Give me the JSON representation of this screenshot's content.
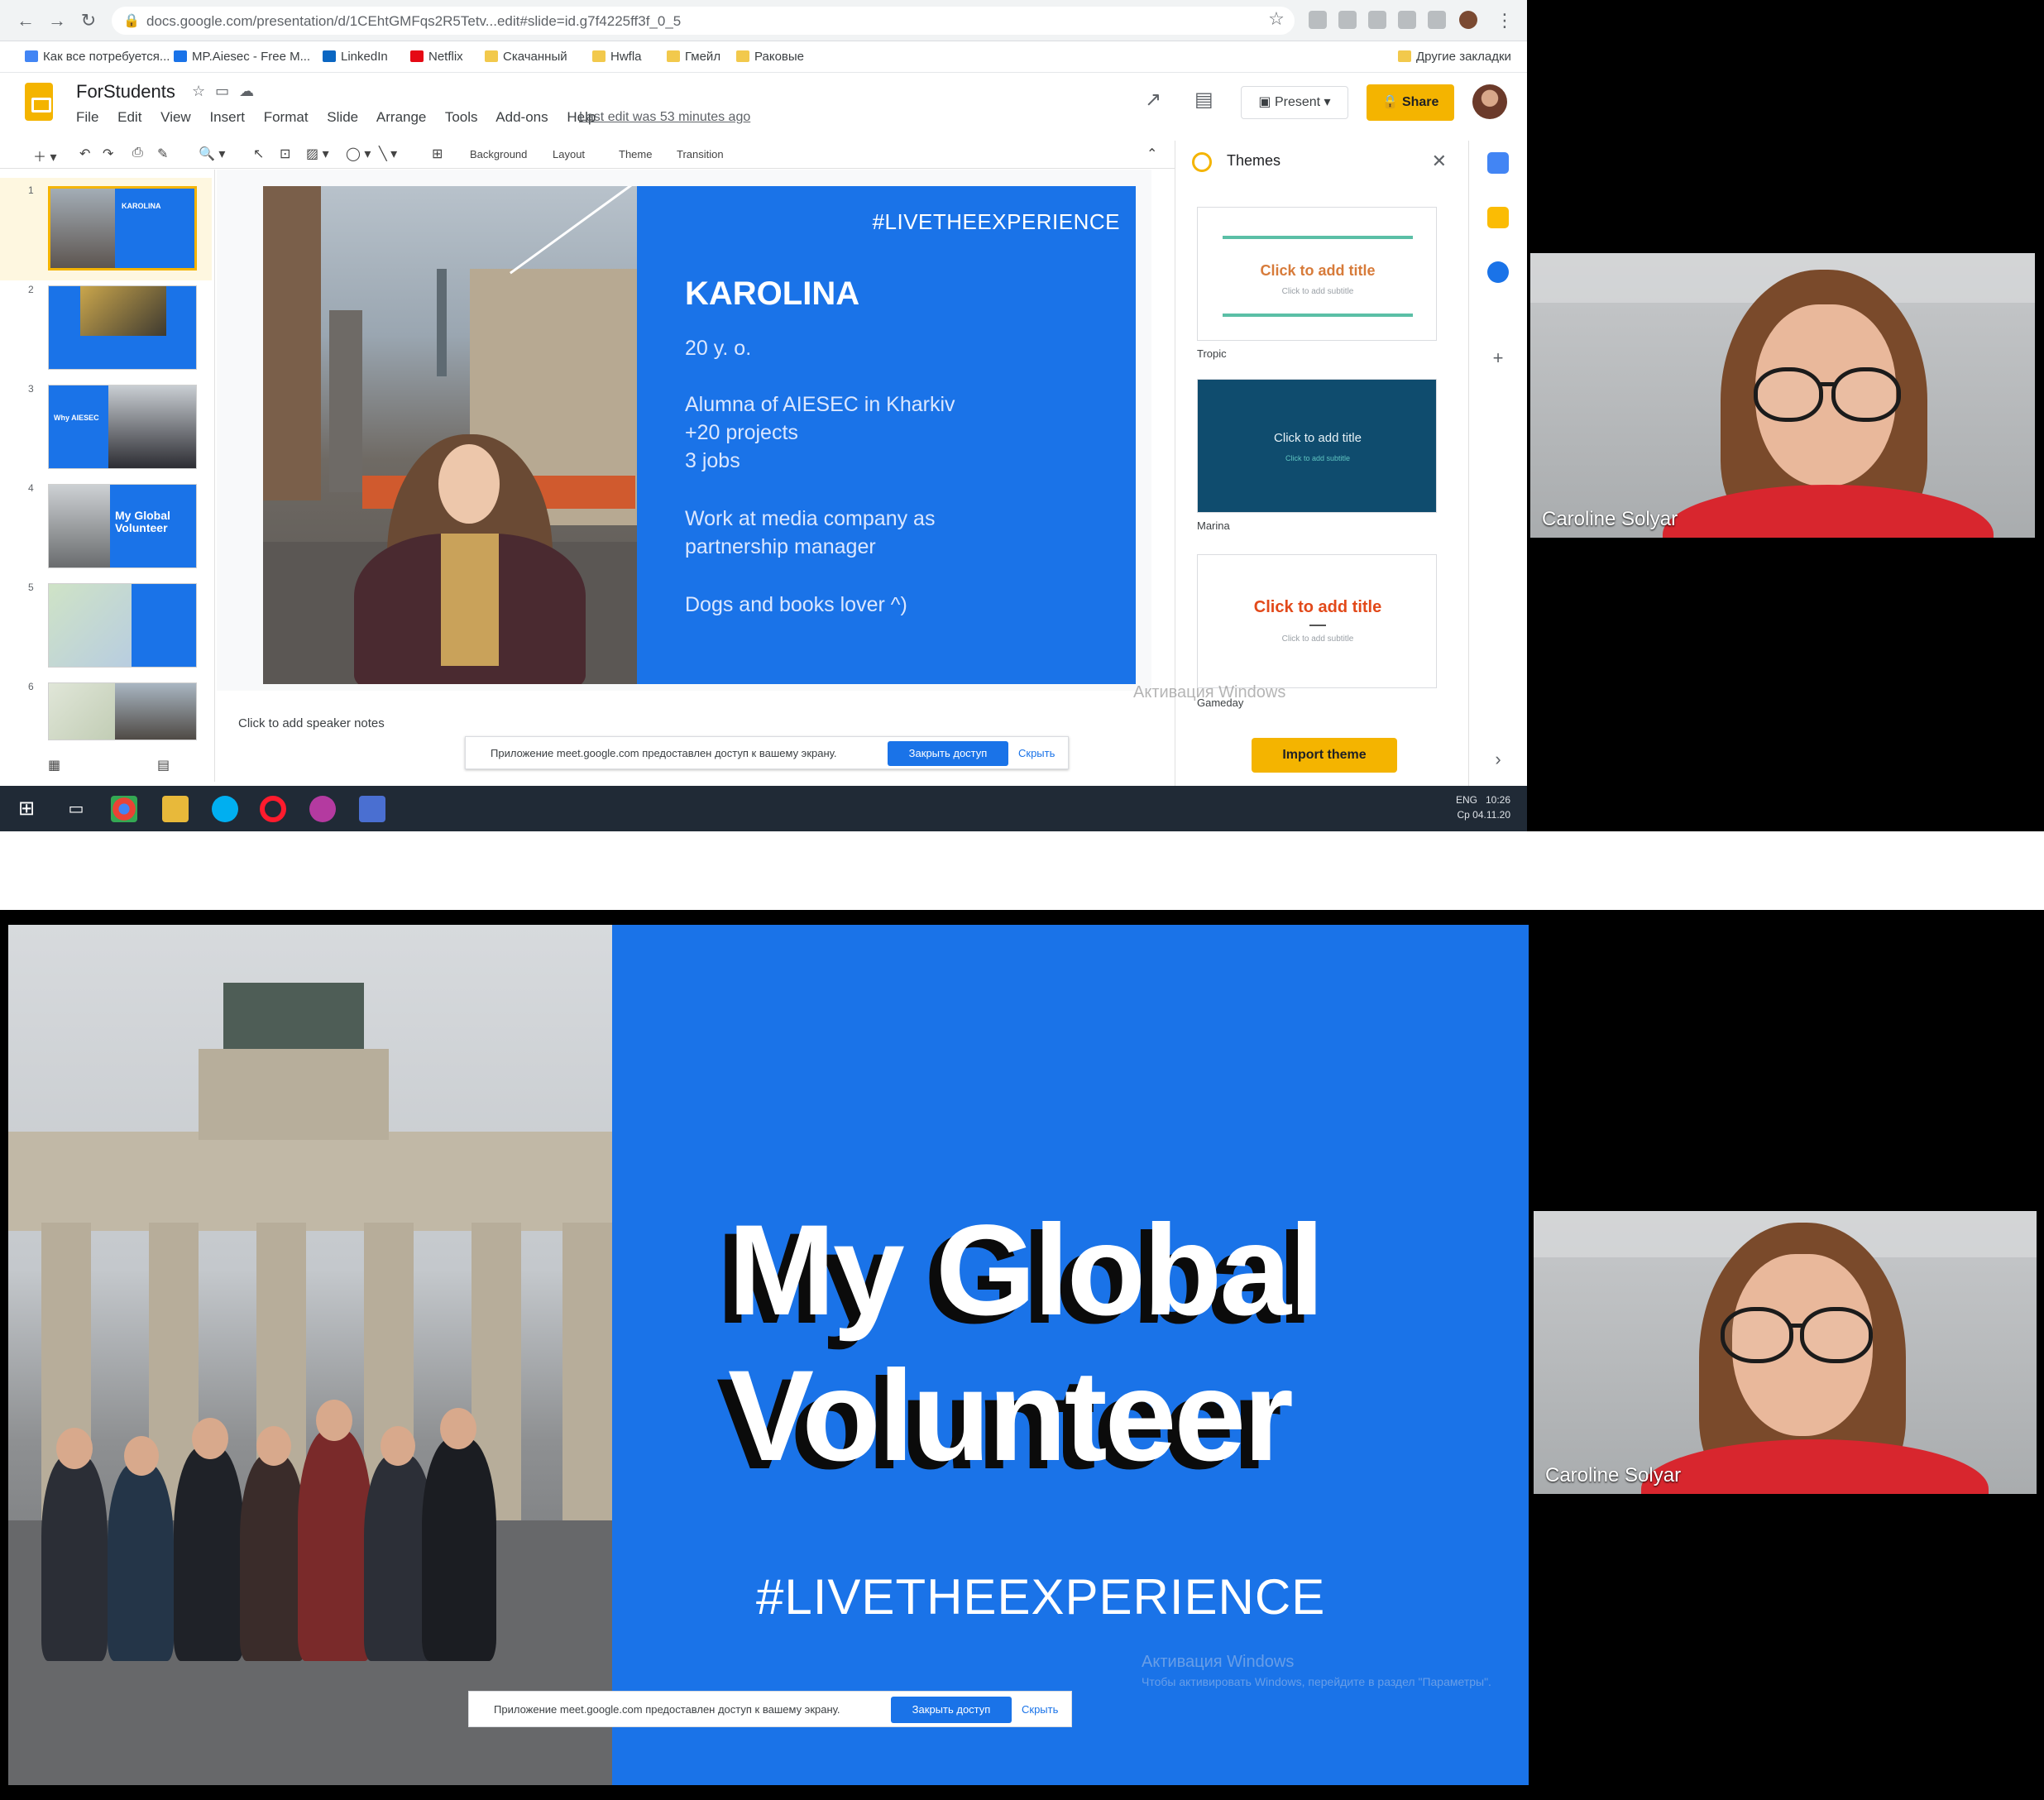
{
  "browser": {
    "url": "docs.google.com/presentation/d/1CEhtGMFqs2R5Tetv...edit#slide=id.g7f4225ff3f_0_5",
    "bookmarks": [
      "Как все потребуется...",
      "MP.Aiesec - Free M...",
      "LinkedIn",
      "Netflix",
      "Скачанный",
      "Hwfla",
      "Гмейл",
      "Раковые"
    ],
    "bookmarks_right": "Другие закладки"
  },
  "slides": {
    "title": "ForStudents",
    "menu": [
      "File",
      "Edit",
      "View",
      "Insert",
      "Format",
      "Slide",
      "Arrange",
      "Tools",
      "Add-ons",
      "Help"
    ],
    "last_edit": "Last edit was 53 minutes ago",
    "present_label": "Present",
    "share_label": "Share",
    "toolbar": {
      "background": "Background",
      "layout": "Layout",
      "theme": "Theme",
      "transition": "Transition"
    },
    "speaker_notes": "Click to add speaker notes",
    "thumbnails": [
      {
        "num": "1",
        "title": "KAROLINA"
      },
      {
        "num": "2",
        "title": ""
      },
      {
        "num": "3",
        "title": "Why AIESEC"
      },
      {
        "num": "4",
        "title": "My Global Volunteer"
      },
      {
        "num": "5",
        "title": ""
      },
      {
        "num": "6",
        "title": ""
      }
    ],
    "current_slide": {
      "hashtag": "#LIVETHEEXPERIENCE",
      "name": "KAROLINA",
      "lines": [
        "20 y. o.",
        "Alumna of AIESEC in Kharkiv",
        "+20 projects",
        "3 jobs",
        "Work at media company as",
        "partnership manager",
        "Dogs and books lover ^)"
      ]
    }
  },
  "themes_panel": {
    "header": "Themes",
    "themes": [
      {
        "name": "Tropic",
        "card_title": "Click to add title",
        "card_sub": "Click to add subtitle"
      },
      {
        "name": "Marina",
        "card_title": "Click to add title",
        "card_sub": "Click to add subtitle"
      },
      {
        "name": "Gameday",
        "card_title": "Click to add title",
        "card_sub": "Click to add subtitle"
      }
    ],
    "import_label": "Import theme"
  },
  "screen_share": {
    "message": "Приложение meet.google.com предоставлен доступ к вашему экрану.",
    "stop_label": "Закрыть доступ",
    "hide_label": "Скрыть"
  },
  "taskbar": {
    "lang": "ENG",
    "time": "10:26",
    "date": "Ср 04.11.20"
  },
  "activation": {
    "title": "Активация Windows",
    "sub": "Чтобы активировать Windows, перейдите в раздел \"Параметры\"."
  },
  "participant": {
    "name": "Caroline Solyar"
  },
  "bottom_slide": {
    "title_line1": "My Global",
    "title_line2": "Volunteer",
    "hashtag": "#LIVETHEEXPERIENCE"
  },
  "colors": {
    "slide_blue": "#1a73e8",
    "share_yellow": "#f4b400"
  }
}
